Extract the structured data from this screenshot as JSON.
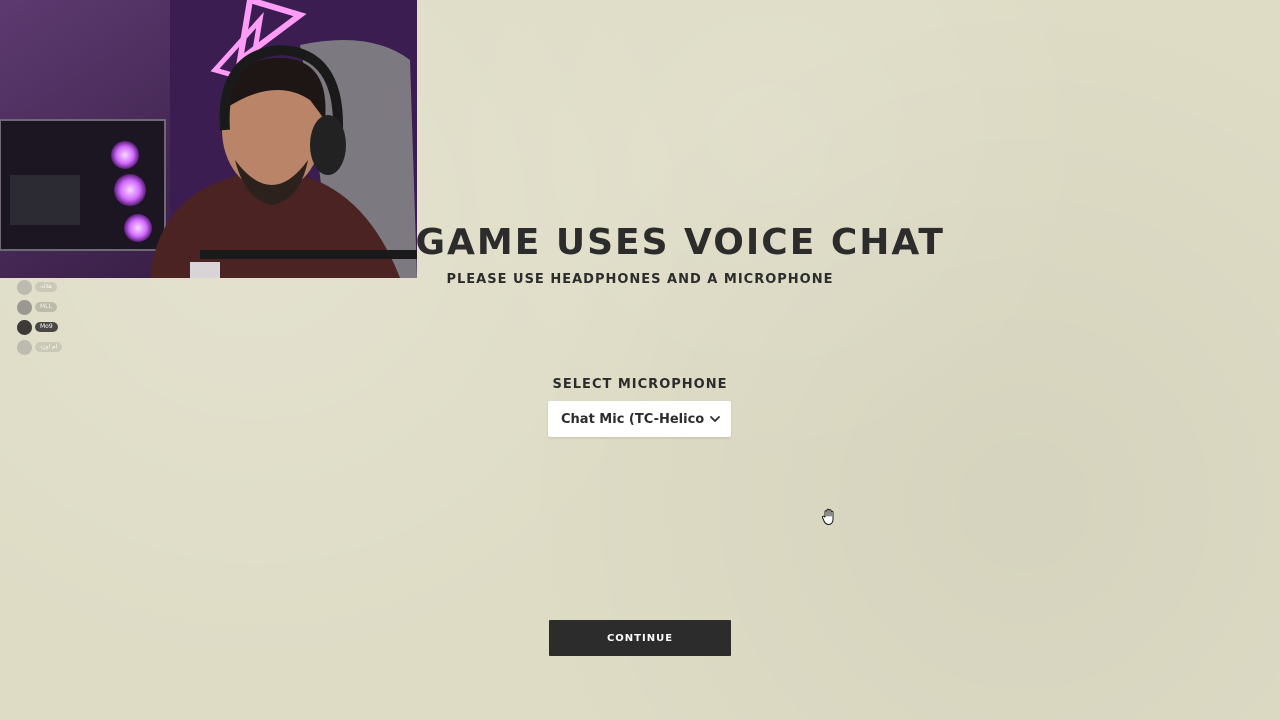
{
  "webcam": {
    "description_icon": "webcam-feed-icon"
  },
  "participants": [
    {
      "name": "هلالہ",
      "state": "faded"
    },
    {
      "name": "MLL",
      "state": "normal"
    },
    {
      "name": "Mo9",
      "state": "active"
    },
    {
      "name": "ام اوزد",
      "state": "faded"
    }
  ],
  "main": {
    "headline": "S GAME USES VOICE CHAT",
    "subline": "PLEASE USE HEADPHONES AND A MICROPHONE",
    "mic_label": "SELECT MICROPHONE",
    "mic_value": "Chat Mic (TC-Helico",
    "continue_label": "CONTINUE"
  },
  "icons": {
    "dropdown": "chevron-down-icon",
    "cursor": "hand-cursor-icon"
  },
  "colors": {
    "background": "#dedcc5",
    "text": "#2c2c2c",
    "button": "#2c2c2c",
    "select_bg": "#ffffff"
  }
}
